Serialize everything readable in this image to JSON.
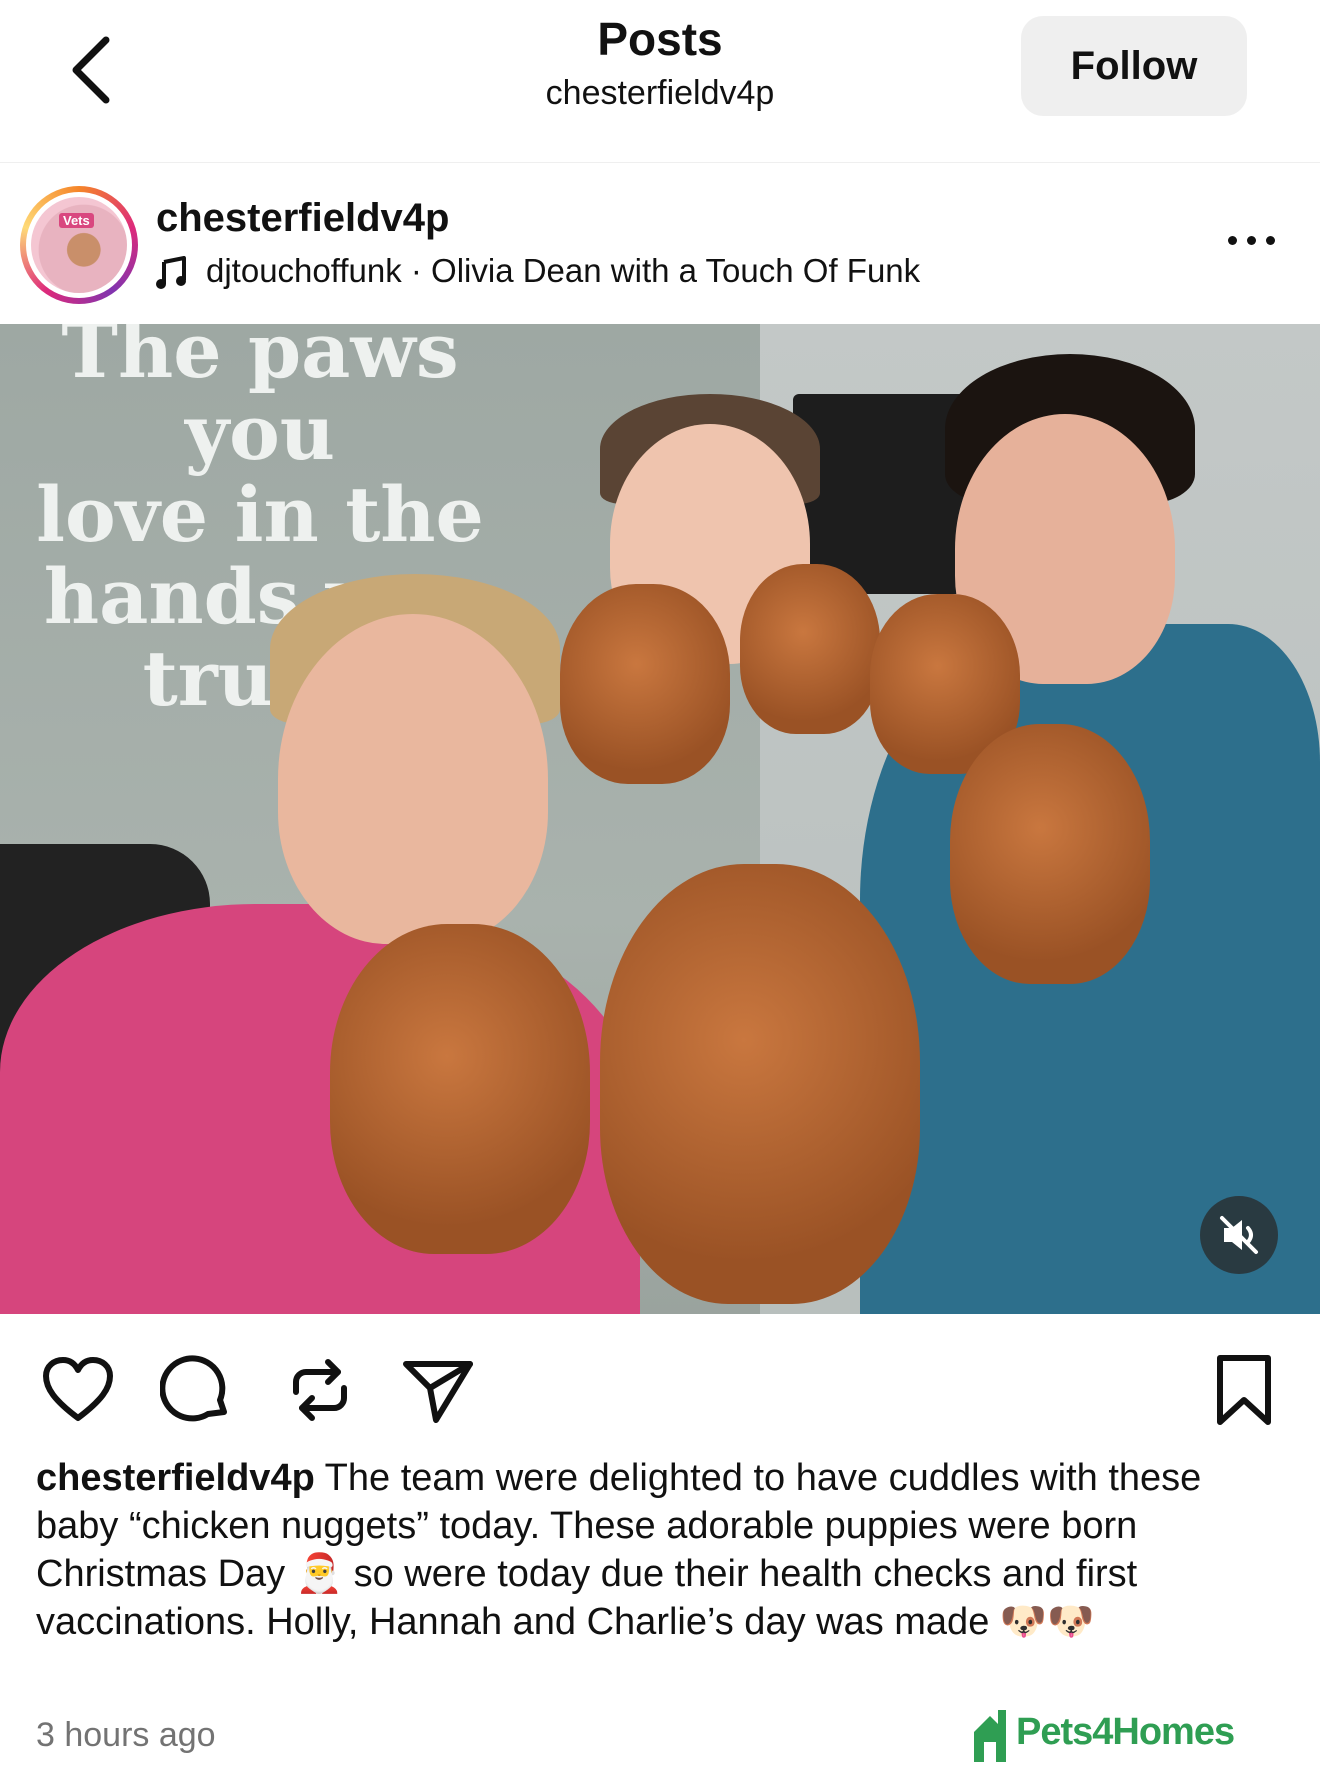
{
  "header": {
    "title": "Posts",
    "subtitle": "chesterfieldv4p",
    "follow_label": "Follow"
  },
  "post": {
    "username": "chesterfieldv4p",
    "avatar_brand": "Vets 4 Pets",
    "audio": "djtouchoffunk · Olivia Dean with a Touch Of Funk",
    "image_wall_text": [
      "The paws you",
      "love in the",
      "hands you trust."
    ],
    "caption_username": "chesterfieldv4p",
    "caption_text": "The team were delighted to have cuddles with these baby “chicken nuggets” today. These adorable puppies were born Christmas Day 🎅 so were today due their health checks and first vaccinations. Holly, Hannah and Charlie’s day was made 🐶🐶",
    "timestamp": "3 hours ago",
    "watermark": "Pets4Homes"
  },
  "icons": {
    "back": "chevron-left-icon",
    "more": "more-horizontal-icon",
    "music": "music-note-icon",
    "mute": "volume-mute-icon",
    "like": "heart-icon",
    "comment": "comment-icon",
    "repost": "repost-icon",
    "share": "send-icon",
    "save": "bookmark-icon"
  },
  "colors": {
    "follow_bg": "#efefef",
    "watermark": "#2f9e53",
    "timestamp": "#737373"
  }
}
